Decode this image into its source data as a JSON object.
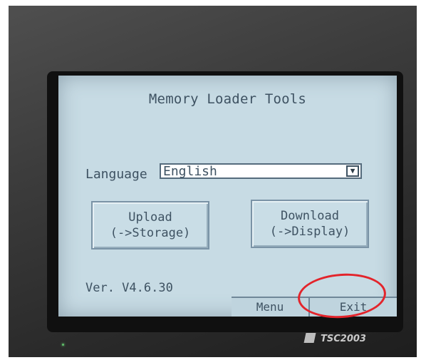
{
  "screen": {
    "title": "Memory Loader Tools",
    "language": {
      "label": "Language",
      "selected": "English",
      "dropdown_icon": "triangle-down-icon"
    },
    "buttons": {
      "upload": {
        "line1": "Upload",
        "line2": "(->Storage)"
      },
      "download": {
        "line1": "Download",
        "line2": "(->Display)"
      }
    },
    "version": "Ver. V4.6.30",
    "tabs": {
      "menu": "Menu",
      "exit": "Exit"
    }
  },
  "device": {
    "model": "TSC2003"
  },
  "colors": {
    "lcd_background": "#c7dbe4",
    "lcd_text": "#3e5262",
    "annotation": "#e3242b"
  }
}
